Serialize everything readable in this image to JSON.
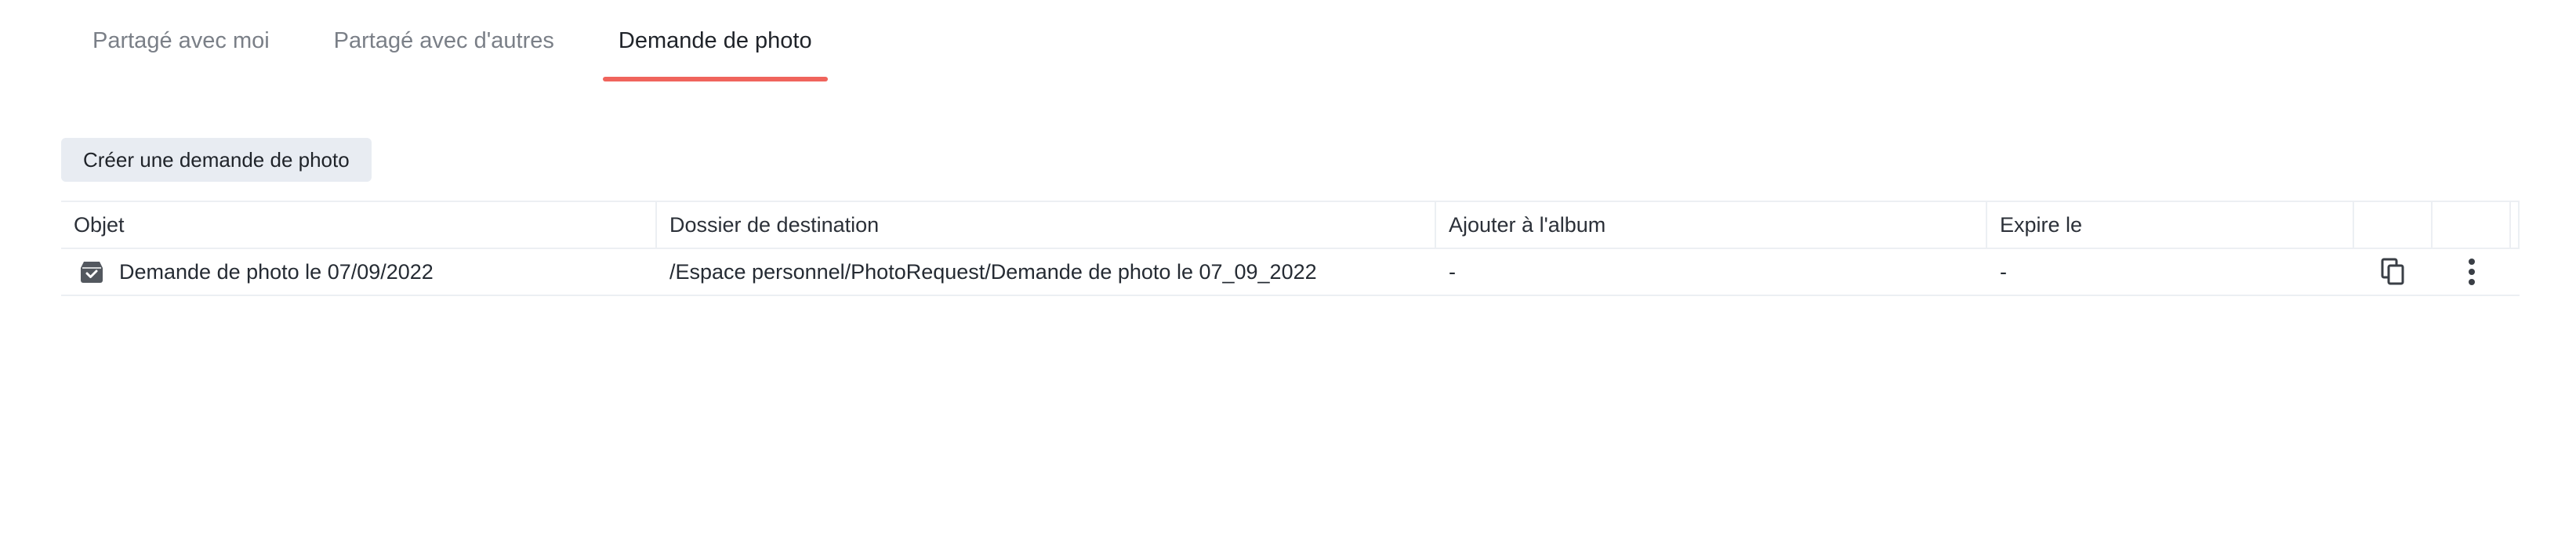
{
  "tabs": [
    {
      "label": "Partagé avec moi",
      "active": false
    },
    {
      "label": "Partagé avec d'autres",
      "active": false
    },
    {
      "label": "Demande de photo",
      "active": true
    }
  ],
  "toolbar": {
    "create_label": "Créer une demande de photo"
  },
  "table": {
    "columns": [
      "Objet",
      "Dossier de destination",
      "Ajouter à l'album",
      "Expire le"
    ],
    "rows": [
      {
        "object": "Demande de photo le 07/09/2022",
        "destination": "/Espace personnel/PhotoRequest/Demande de photo le 07_09_2022",
        "album": "-",
        "expires": "-",
        "icon": "photo-request-icon"
      }
    ]
  },
  "colors": {
    "accent": "#f0645c",
    "button_bg": "#e8ecf2",
    "border": "#eceff3",
    "tab_inactive": "#7a7f87"
  },
  "icons": {
    "copy": "copy-icon",
    "more": "more-vertical-icon"
  }
}
